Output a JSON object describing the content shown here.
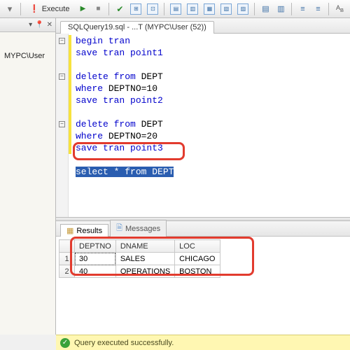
{
  "toolbar": {
    "execute_label": "Execute"
  },
  "sidebar": {
    "node": "MYPC\\User"
  },
  "tab": {
    "title": "SQLQuery19.sql - ...T (MYPC\\User (52))"
  },
  "code": {
    "l1a": "begin",
    "l1b": " tran",
    "l2a": "save",
    "l2b": " tran point1",
    "l3": "",
    "l4a": "delete",
    "l4b": " from",
    "l4c": " DEPT",
    "l5a": "where",
    "l5b": " DEPTNO=10",
    "l6a": "save",
    "l6b": " tran point2",
    "l7": "",
    "l8a": "delete",
    "l8b": " from",
    "l8c": " DEPT",
    "l9a": "where",
    "l9b": " DEPTNO=20",
    "l10a": "save",
    "l10b": " tran point3",
    "l11": "",
    "l12": "select * from DEPT"
  },
  "results": {
    "tab_results": "Results",
    "tab_messages": "Messages",
    "columns": [
      "DEPTNO",
      "DNAME",
      "LOC"
    ],
    "rows": [
      {
        "n": "1",
        "DEPTNO": "30",
        "DNAME": "SALES",
        "LOC": "CHICAGO"
      },
      {
        "n": "2",
        "DEPTNO": "40",
        "DNAME": "OPERATIONS",
        "LOC": "BOSTON"
      }
    ]
  },
  "status": {
    "text": "Query executed successfully."
  },
  "icons": {
    "pin": "📌",
    "close": "✕",
    "dropdown": "▾",
    "exclaim": "❗",
    "grid": "▦",
    "msg": "📄"
  }
}
